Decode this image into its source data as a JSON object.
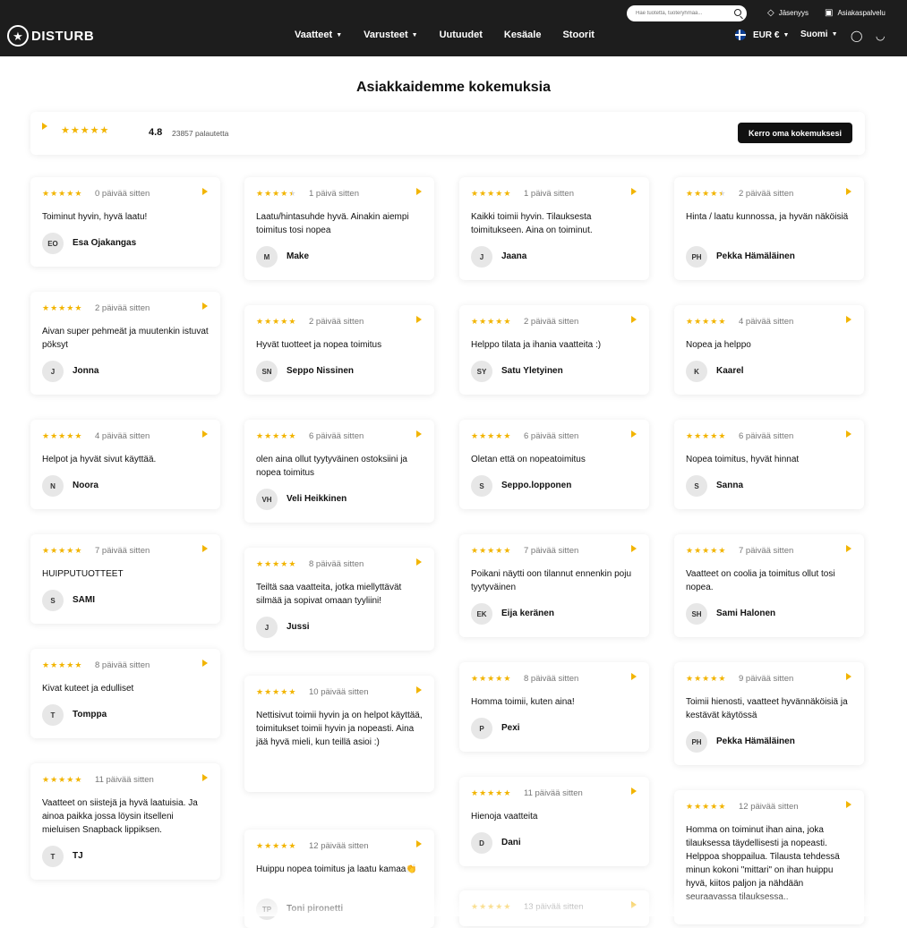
{
  "header": {
    "logo_text": "DISTURB",
    "search_placeholder": "Hae tuotetta, tuoteryhmää...",
    "membership_label": "Jäsenyys",
    "customer_service_label": "Asiakaspalvelu",
    "nav": [
      "Vaatteet",
      "Varusteet",
      "Uutuudet",
      "Kesäale",
      "Stoorit"
    ],
    "currency": "EUR €",
    "language": "Suomi"
  },
  "page_title": "Asiakkaidemme kokemuksia",
  "summary": {
    "rating": "4.8",
    "stars": 5,
    "count_label": "23857 palautetta",
    "write_button": "Kerro oma kokemuksesi"
  },
  "reviews": [
    {
      "stars": 5,
      "date": "0 päivää sitten",
      "text": "Toiminut hyvin, hyvä laatu!",
      "initials": "EO",
      "name": "Esa Ojakangas"
    },
    {
      "stars": 4.5,
      "date": "1 päivä sitten",
      "text": "Laatu/hintasuhde hyvä. Ainakin aiempi toimitus tosi nopea",
      "initials": "M",
      "name": "Make"
    },
    {
      "stars": 5,
      "date": "1 päivä sitten",
      "text": "Kaikki toimii hyvin. Tilauksesta toimitukseen. Aina on toiminut.",
      "initials": "J",
      "name": "Jaana"
    },
    {
      "stars": 4.5,
      "date": "2 päivää sitten",
      "text": "Hinta / laatu kunnossa, ja hyvän näköisiä",
      "initials": "PH",
      "name": "Pekka Hämäläinen"
    },
    {
      "stars": 5,
      "date": "2 päivää sitten",
      "text": "Aivan super pehmeät ja muutenkin istuvat pöksyt",
      "initials": "J",
      "name": "Jonna"
    },
    {
      "stars": 5,
      "date": "2 päivää sitten",
      "text": "Hyvät tuotteet ja nopea toimitus",
      "initials": "SN",
      "name": "Seppo Nissinen"
    },
    {
      "stars": 5,
      "date": "2 päivää sitten",
      "text": "Helppo tilata ja ihania vaatteita :)",
      "initials": "SY",
      "name": "Satu Yletyinen"
    },
    {
      "stars": 5,
      "date": "4 päivää sitten",
      "text": "Nopea ja helppo",
      "initials": "K",
      "name": "Kaarel"
    },
    {
      "stars": 5,
      "date": "4 päivää sitten",
      "text": "Helpot ja hyvät sivut käyttää.",
      "initials": "N",
      "name": "Noora"
    },
    {
      "stars": 5,
      "date": "6 päivää sitten",
      "text": "olen aina ollut tyytyväinen ostoksiini ja nopea toimitus",
      "initials": "VH",
      "name": "Veli Heikkinen"
    },
    {
      "stars": 5,
      "date": "6 päivää sitten",
      "text": "Oletan että on nopeatoimitus",
      "initials": "S",
      "name": "Seppo.lopponen"
    },
    {
      "stars": 5,
      "date": "6 päivää sitten",
      "text": "Nopea toimitus, hyvät hinnat",
      "initials": "S",
      "name": "Sanna"
    },
    {
      "stars": 5,
      "date": "7 päivää sitten",
      "text": "HUIPPUTUOTTEET",
      "initials": "S",
      "name": "SAMI"
    },
    {
      "stars": 5,
      "date": "8 päivää sitten",
      "text": "Teiltä saa vaatteita, jotka miellyttävät silmää ja sopivat omaan tyyliini!",
      "initials": "J",
      "name": "Jussi"
    },
    {
      "stars": 5,
      "date": "7 päivää sitten",
      "text": "Poikani näytti oon tilannut ennenkin poju tyytyväinen",
      "initials": "EK",
      "name": "Eija keränen"
    },
    {
      "stars": 5,
      "date": "7 päivää sitten",
      "text": "Vaatteet on coolia ja toimitus ollut tosi nopea.",
      "initials": "SH",
      "name": "Sami Halonen"
    },
    {
      "stars": 5,
      "date": "8 päivää sitten",
      "text": "Kivat kuteet ja edulliset",
      "initials": "T",
      "name": "Tomppa"
    },
    {
      "stars": 5,
      "date": "10 päivää sitten",
      "text": "Nettisivut toimii hyvin ja on helpot käyttää, toimitukset toimii hyvin ja nopeasti. Aina jää hyvä mieli, kun teillä asioi :)",
      "initials": "J",
      "name": "Jaana"
    },
    {
      "stars": 5,
      "date": "8 päivää sitten",
      "text": "Homma toimii, kuten aina!",
      "initials": "P",
      "name": "Pexi"
    },
    {
      "stars": 5,
      "date": "9 päivää sitten",
      "text": "Toimii hienosti, vaatteet hyvännäköisiä ja kestävät käytössä",
      "initials": "PH",
      "name": "Pekka Hämäläinen"
    },
    {
      "stars": 5,
      "date": "11 päivää sitten",
      "text": "Vaatteet on siistejä ja hyvä laatuisia. Ja ainoa paikka jossa löysin itselleni mieluisen Snapback lippiksen.",
      "initials": "T",
      "name": "TJ"
    },
    {
      "stars": 5,
      "date": "12 päivää sitten",
      "text": "Huippu nopea toimitus ja laatu kamaa👏",
      "initials": "TP",
      "name": "Toni pironetti"
    },
    {
      "stars": 5,
      "date": "11 päivää sitten",
      "text": "Hienoja vaatteita",
      "initials": "D",
      "name": "Dani"
    },
    {
      "stars": 5,
      "date": "12 päivää sitten",
      "text": "Homma on toiminut ihan aina, joka tilauksessa täydellisesti ja nopeasti. Helppoa shoppailua. Tilausta tehdessä minun kokoni \"mittari\" on ihan huippu hyvä, kiitos paljon ja nähdään seuraavassa tilauksessa..",
      "initials": "",
      "name": ""
    },
    {
      "stars": 5,
      "date": "13 päivää sitten",
      "text": "",
      "initials": "",
      "name": ""
    }
  ]
}
